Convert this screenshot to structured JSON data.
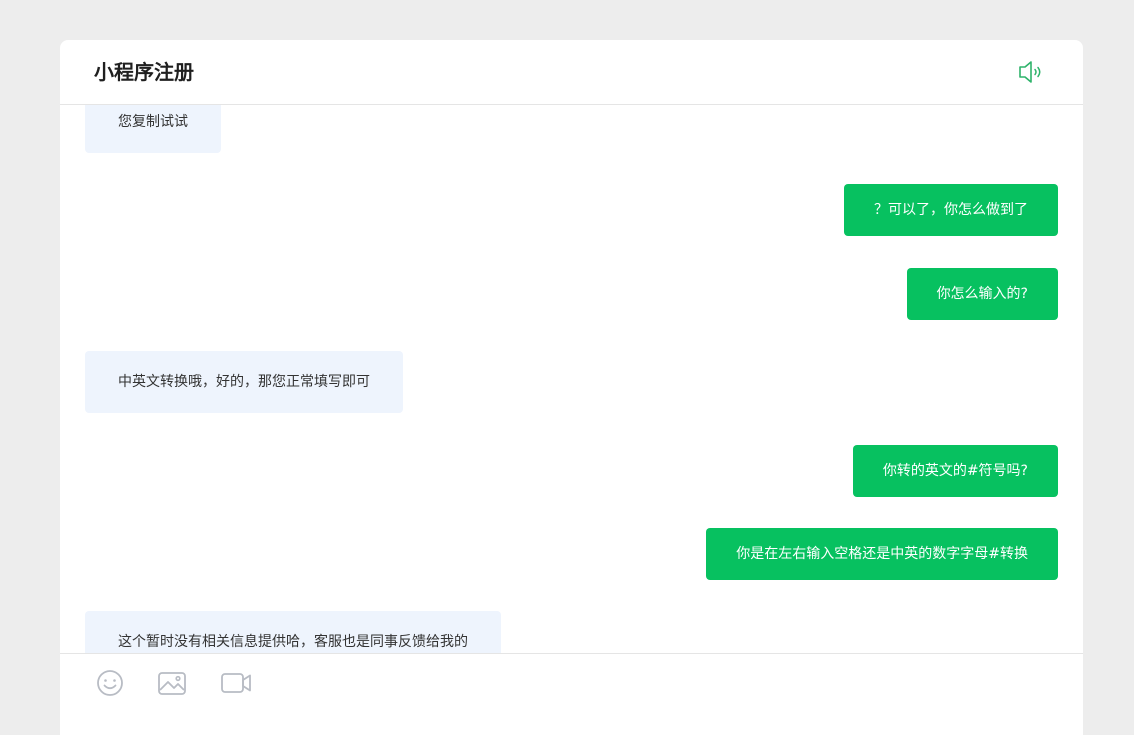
{
  "header": {
    "title": "小程序注册",
    "speaker_icon": "speaker-icon"
  },
  "messages": [
    {
      "side": "left",
      "text": "您复制试试"
    },
    {
      "side": "right",
      "text": "？可以了，你怎么做到了"
    },
    {
      "side": "right",
      "text": "你怎么输入的?"
    },
    {
      "side": "left",
      "text": "中英文转换哦，好的，那您正常填写即可"
    },
    {
      "side": "right",
      "text": "你转的英文的#符号吗?"
    },
    {
      "side": "right",
      "text": "你是在左右输入空格还是中英的数字字母#转换"
    },
    {
      "side": "left",
      "text": "这个暂时没有相关信息提供哈，客服也是同事反馈给我的"
    }
  ],
  "toolbar": {
    "icons": [
      "emoji-icon",
      "image-icon",
      "video-icon"
    ]
  },
  "colors": {
    "accent": "#07c160",
    "left_bubble": "#eef4fd",
    "icon_gray": "#b8bcc4",
    "speaker_green": "#2fb36b"
  }
}
